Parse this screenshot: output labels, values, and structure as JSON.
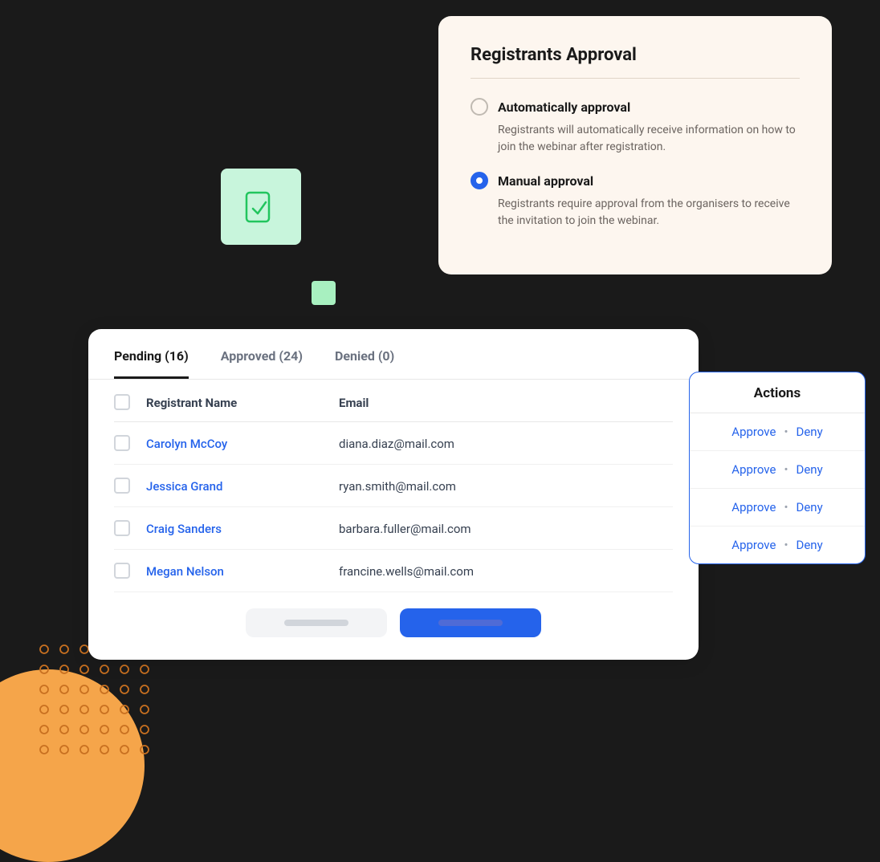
{
  "approval_panel": {
    "title": "Registrants Approval",
    "divider": true,
    "options": [
      {
        "id": "auto",
        "label": "Automatically approval",
        "description": "Registrants will automatically receive information on how to join the webinar after registration.",
        "selected": false
      },
      {
        "id": "manual",
        "label": "Manual approval",
        "description": "Registrants require approval from the organisers to receive the invitation to join the webinar.",
        "selected": true
      }
    ]
  },
  "tabs": [
    {
      "label": "Pending (16)",
      "active": true
    },
    {
      "label": "Approved (24)",
      "active": false
    },
    {
      "label": "Denied (0)",
      "active": false
    }
  ],
  "table": {
    "columns": [
      {
        "id": "check",
        "label": ""
      },
      {
        "id": "name",
        "label": "Registrant Name"
      },
      {
        "id": "email",
        "label": "Email"
      }
    ],
    "rows": [
      {
        "name": "Carolyn McCoy",
        "email": "diana.diaz@mail.com"
      },
      {
        "name": "Jessica Grand",
        "email": "ryan.smith@mail.com"
      },
      {
        "name": "Craig Sanders",
        "email": "barbara.fuller@mail.com"
      },
      {
        "name": "Megan Nelson",
        "email": "francine.wells@mail.com"
      }
    ]
  },
  "buttons": {
    "cancel_label": "",
    "save_label": ""
  },
  "actions_panel": {
    "title": "Actions",
    "rows": [
      {
        "approve": "Approve",
        "dot": "•",
        "deny": "Deny"
      },
      {
        "approve": "Approve",
        "dot": "•",
        "deny": "Deny"
      },
      {
        "approve": "Approve",
        "dot": "•",
        "deny": "Deny"
      },
      {
        "approve": "Approve",
        "dot": "•",
        "deny": "Deny"
      }
    ]
  }
}
